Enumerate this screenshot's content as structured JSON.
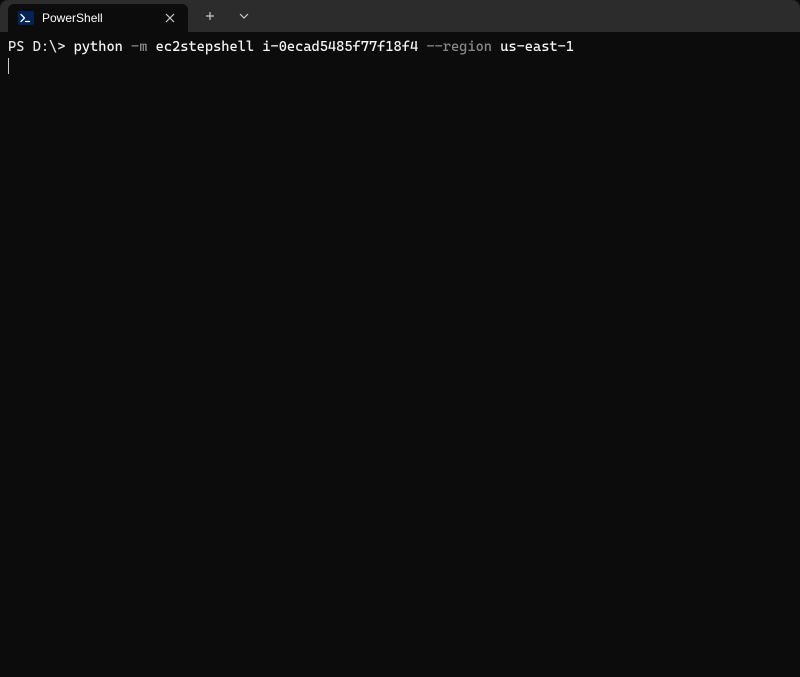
{
  "tab": {
    "title": "PowerShell"
  },
  "terminal": {
    "prompt": "PS D:\\> ",
    "cmd_python": "python",
    "cmd_flag_m": " -m ",
    "cmd_module": "ec2stepshell",
    "cmd_space1": " ",
    "cmd_instance": "i-0ecad5485f77f18f4",
    "cmd_flag_region": " --region ",
    "cmd_region": "us-east-1"
  }
}
